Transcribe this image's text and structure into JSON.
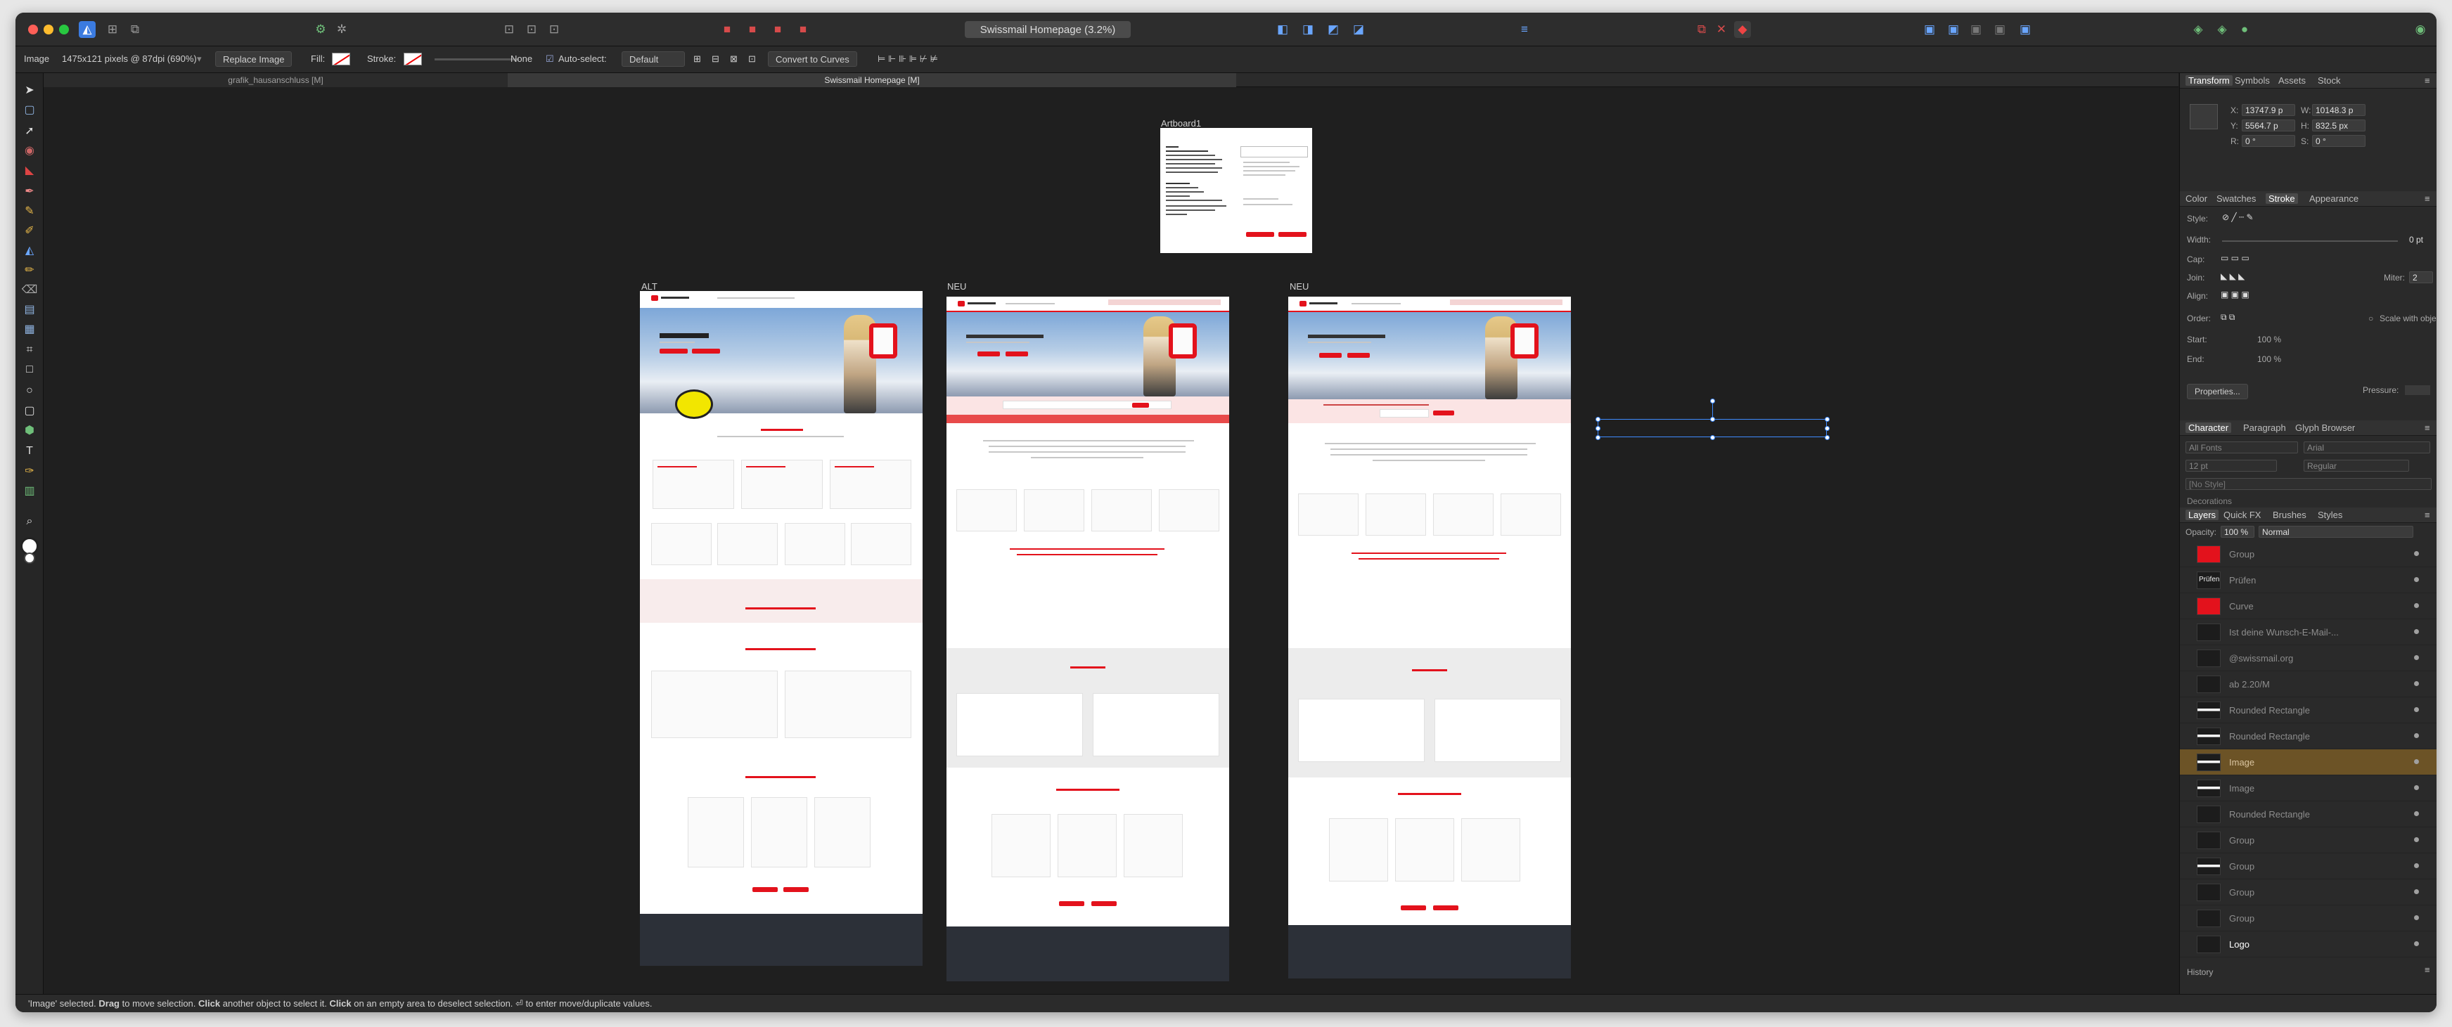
{
  "app": {
    "document_title": "Swissmail Homepage (3.2%)"
  },
  "context_toolbar": {
    "object_type": "Image",
    "image_info": "1475x121 pixels @ 87dpi (690%)",
    "replace_image": "Replace Image",
    "fill_label": "Fill:",
    "stroke_label": "Stroke:",
    "stroke_none": "None",
    "auto_select_label": "Auto-select:",
    "auto_select_value": "Default",
    "convert_to_curves": "Convert to Curves"
  },
  "doc_tabs": [
    "grafik_hausanschluss [M]",
    "Swissmail Homepage [M]"
  ],
  "artboards": {
    "a1": "Artboard1",
    "alt": "ALT",
    "neu1": "NEU",
    "neu2": "NEU"
  },
  "transform": {
    "tabs": [
      "Transform",
      "Symbols",
      "Assets",
      "Stock"
    ],
    "x": "13747.9 p",
    "y": "5564.7 p",
    "w": "10148.3 p",
    "h": "832.5 px",
    "r": "0 °",
    "s": "0 °",
    "x_label": "X:",
    "y_label": "Y:",
    "w_label": "W:",
    "h_label": "H:",
    "r_label": "R:",
    "s_label": "S:"
  },
  "stroke_panel": {
    "tabs": [
      "Color",
      "Swatches",
      "Stroke",
      "Appearance"
    ],
    "style": "Style:",
    "width": "Width:",
    "width_value": "0 pt",
    "cap": "Cap:",
    "join": "Join:",
    "miter": "Miter:",
    "miter_value": "2",
    "align": "Align:",
    "order": "Order:",
    "scale_with_object": "Scale with object",
    "start": "Start:",
    "end": "End:",
    "start_pct": "100 %",
    "end_pct": "100 %",
    "properties": "Properties...",
    "pressure": "Pressure:"
  },
  "character": {
    "tabs": [
      "Character",
      "Paragraph",
      "Glyph Browser"
    ],
    "font_collection": "All Fonts",
    "font": "Arial",
    "size": "12 pt",
    "weight": "Regular",
    "style": "[No Style]",
    "decorations": "Decorations"
  },
  "layers_panel": {
    "tabs": [
      "Layers",
      "Quick FX",
      "Brushes",
      "Styles"
    ],
    "opacity_label": "Opacity:",
    "opacity": "100 %",
    "blend": "Normal",
    "items": [
      "Group",
      "Prüfen",
      "Curve",
      "Ist deine Wunsch-E-Mail-...",
      "@swissmail.org",
      "ab 2.20/M",
      "Rounded Rectangle",
      "Rounded Rectangle",
      "Image",
      "Image",
      "Rounded Rectangle",
      "Group",
      "Group",
      "Group",
      "Group",
      "Logo"
    ],
    "thumb_prufen": "Prüfen"
  },
  "history": "History",
  "status": {
    "selected": "'Image' selected.",
    "drag": "Drag",
    "move_text": "to move selection.",
    "click": "Click",
    "another_text": "another object to select it.",
    "click2": "Click",
    "empty_text": "on an empty area to deselect selection.",
    "enter_text": "⏎ to enter move/duplicate values."
  },
  "colors": {
    "accent_red": "#e3121c",
    "selection_blue": "#3e8bff",
    "layer_selected": "#6c5326"
  }
}
